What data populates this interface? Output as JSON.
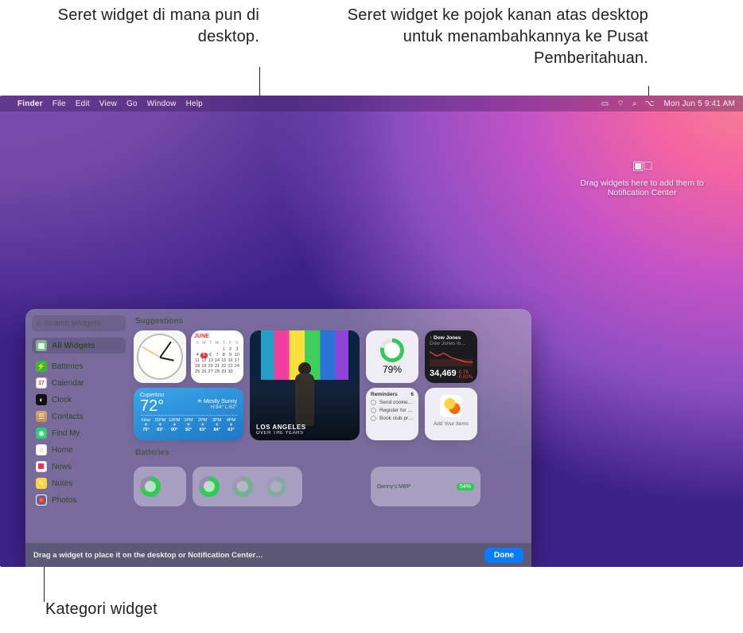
{
  "callouts": {
    "left": "Seret widget di mana pun di desktop.",
    "right": "Seret widget ke pojok kanan atas desktop untuk menambahkannya ke Pusat Pemberitahuan.",
    "bottom": "Kategori widget"
  },
  "menubar": {
    "app": "Finder",
    "items": [
      "File",
      "Edit",
      "View",
      "Go",
      "Window",
      "Help"
    ],
    "datetime": "Mon Jun 5  9:41 AM"
  },
  "drop_hint": {
    "text": "Drag widgets here to add them to Notification Center"
  },
  "sidebar": {
    "search_placeholder": "Search Widgets",
    "all_label": "All Widgets",
    "categories": [
      {
        "label": "Batteries"
      },
      {
        "label": "Calendar",
        "day": "17"
      },
      {
        "label": "Clock"
      },
      {
        "label": "Contacts"
      },
      {
        "label": "Find My"
      },
      {
        "label": "Home"
      },
      {
        "label": "News"
      },
      {
        "label": "Notes"
      },
      {
        "label": "Photos"
      }
    ]
  },
  "sections": {
    "suggestions": "Suggestions",
    "batteries": "Batteries"
  },
  "widgets": {
    "calendar": {
      "month": "June",
      "weekdays": [
        "S",
        "M",
        "T",
        "W",
        "T",
        "F",
        "S"
      ],
      "today": 5,
      "days_count": 30,
      "start_offset": 4
    },
    "weather": {
      "location": "Cupertino",
      "temp": "72°",
      "condition": "Mostly Sunny",
      "hi_lo": "H:84° L:62°",
      "sun_icon": "☀",
      "hours": [
        {
          "h": "Now",
          "t": "75°"
        },
        {
          "h": "11PM",
          "t": "83°"
        },
        {
          "h": "12PM",
          "t": "90°"
        },
        {
          "h": "1PM",
          "t": "92°"
        },
        {
          "h": "2PM",
          "t": "83°"
        },
        {
          "h": "3PM",
          "t": "84°"
        },
        {
          "h": "4PM",
          "t": "83°"
        }
      ]
    },
    "photos": {
      "title": "LOS ANGELES",
      "subtitle": "OVER THE YEARS"
    },
    "battery": {
      "percent": "79%"
    },
    "stocks": {
      "symbol": "↑ Dow Jones",
      "sub": "Dow Jones In…",
      "value": "34,469",
      "change1": "-0.76",
      "change2": "-0.02%"
    },
    "reminders": {
      "title": "Reminders",
      "count": "6",
      "items": [
        "Send cookie reci…",
        "Register for sem…",
        "Book club prep"
      ]
    },
    "findmy": {
      "label": "Add Your Items"
    },
    "batteries_section": {
      "device_label": "Danny's MBP",
      "device_pct": "54%"
    }
  },
  "footer": {
    "hint": "Drag a widget to place it on the desktop or Notification Center…",
    "done": "Done"
  },
  "chart_data": {
    "type": "line",
    "title": "Dow Jones",
    "series": [
      {
        "name": "Dow Jones",
        "values": [
          34540,
          34510,
          34530,
          34500,
          34485,
          34470,
          34469
        ]
      }
    ],
    "x": [
      0,
      1,
      2,
      3,
      4,
      5,
      6
    ],
    "ylim": [
      34440,
      34560
    ],
    "color": "#ff453a"
  }
}
